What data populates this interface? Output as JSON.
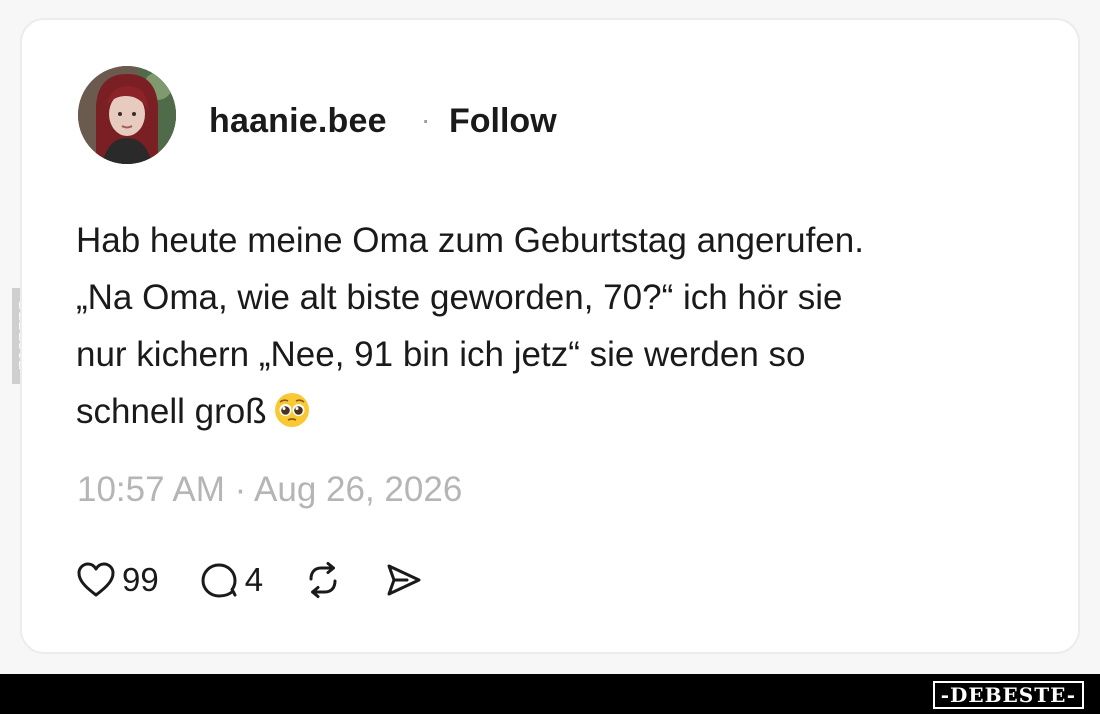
{
  "post": {
    "username": "haanie.bee",
    "separator": "·",
    "follow_label": "Follow",
    "text_lines": [
      "Hab heute meine Oma zum Geburtstag angerufen.",
      "„Na Oma, wie alt biste geworden, 70?“ ich hör sie",
      "nur kichern „Nee, 91 bin ich jetz“ sie werden so",
      "schnell groß"
    ],
    "emoji_name": "pleading-face-emoji",
    "timestamp": "10:57 AM · Aug 26, 2026"
  },
  "actions": {
    "likes_count": "99",
    "comments_count": "4",
    "like_icon": "heart-icon",
    "comment_icon": "comment-bubble-icon",
    "repost_icon": "repost-icon",
    "share_icon": "send-icon"
  },
  "watermark": {
    "side_text": "DEBESTE",
    "footer_logo": "-DEBESTE-"
  }
}
